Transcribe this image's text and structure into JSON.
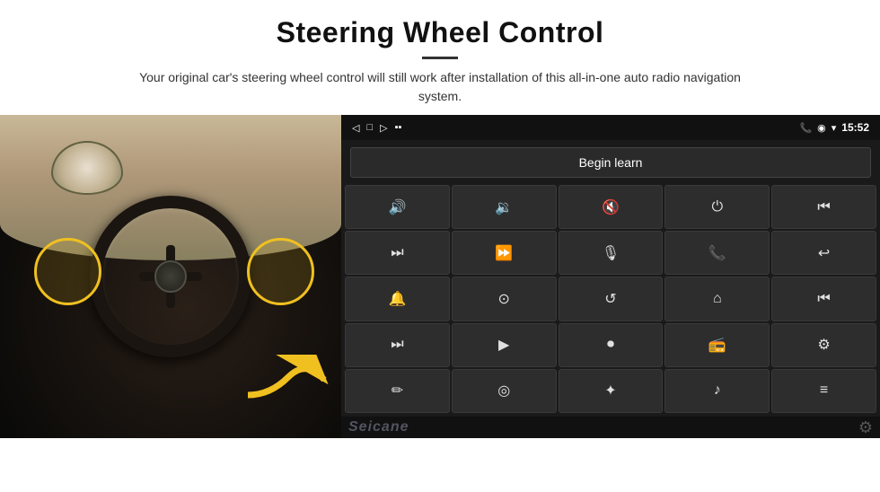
{
  "header": {
    "title": "Steering Wheel Control",
    "subtitle": "Your original car's steering wheel control will still work after installation of this all-in-one auto radio navigation system."
  },
  "statusbar": {
    "time": "15:52",
    "icons": [
      "◁",
      "□",
      "▷"
    ]
  },
  "begin_learn_btn": "Begin learn",
  "controls": [
    {
      "icon": "🔊+",
      "label": "vol-up"
    },
    {
      "icon": "🔊−",
      "label": "vol-down"
    },
    {
      "icon": "🔇",
      "label": "mute"
    },
    {
      "icon": "⏻",
      "label": "power"
    },
    {
      "icon": "📞⏮",
      "label": "call-prev"
    },
    {
      "icon": "⏭",
      "label": "next"
    },
    {
      "icon": "⏩",
      "label": "ff-next"
    },
    {
      "icon": "🎤",
      "label": "mic"
    },
    {
      "icon": "📞",
      "label": "call"
    },
    {
      "icon": "↩",
      "label": "hangup"
    },
    {
      "icon": "📢",
      "label": "audio-src"
    },
    {
      "icon": "360°",
      "label": "360-camera"
    },
    {
      "icon": "↺",
      "label": "back"
    },
    {
      "icon": "⌂",
      "label": "home"
    },
    {
      "icon": "⏮⏮",
      "label": "prev-track"
    },
    {
      "icon": "⏭⏭",
      "label": "fast-fwd"
    },
    {
      "icon": "➤",
      "label": "nav"
    },
    {
      "icon": "⏺",
      "label": "radio"
    },
    {
      "icon": "📻",
      "label": "tuner"
    },
    {
      "icon": "⚙",
      "label": "equalizer"
    },
    {
      "icon": "✏",
      "label": "edit"
    },
    {
      "icon": "🔘",
      "label": "mode"
    },
    {
      "icon": "✱",
      "label": "bluetooth"
    },
    {
      "icon": "🎵",
      "label": "music"
    },
    {
      "icon": "📊",
      "label": "spectrum"
    }
  ],
  "watermark": "Seicane",
  "colors": {
    "bg_dark": "#1a1a1a",
    "btn_bg": "#2d2d2d",
    "accent_yellow": "#f0c020"
  }
}
